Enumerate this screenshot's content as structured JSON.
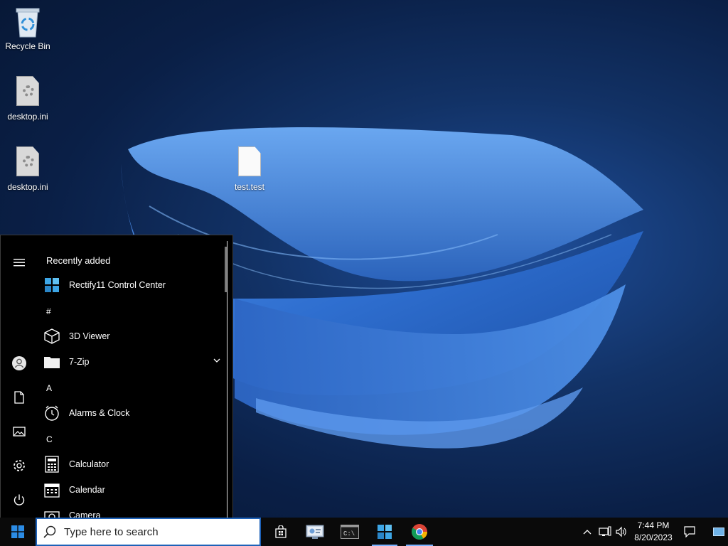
{
  "desktop": {
    "icons": [
      {
        "label": "Recycle Bin",
        "icon": "recycle-bin-icon"
      },
      {
        "label": "desktop.ini",
        "icon": "settings-file-icon"
      },
      {
        "label": "desktop.ini",
        "icon": "settings-file-icon"
      },
      {
        "label": "test.test",
        "icon": "blank-file-icon"
      }
    ]
  },
  "start_menu": {
    "recent_header": "Recently added",
    "recent_app": "Rectify11 Control Center",
    "sections": [
      "#",
      "A",
      "C"
    ],
    "apps": [
      {
        "label": "3D Viewer",
        "icon": "cube-icon"
      },
      {
        "label": "7-Zip",
        "icon": "folder-icon"
      },
      {
        "label": "Alarms & Clock",
        "icon": "clock-icon"
      },
      {
        "label": "Calculator",
        "icon": "calculator-icon"
      },
      {
        "label": "Calendar",
        "icon": "calendar-icon"
      },
      {
        "label": "Camera",
        "icon": "camera-icon"
      }
    ],
    "rail": [
      "menu-icon",
      "user-icon",
      "documents-icon",
      "pictures-icon",
      "settings-icon",
      "power-icon"
    ]
  },
  "taskbar": {
    "search_placeholder": "Type here to search",
    "pinned": [
      "store-icon",
      "control-panel-icon",
      "cmd-icon",
      "rectify11-icon",
      "chrome-icon"
    ],
    "tray": {
      "time": "7:44 PM",
      "date": "8/20/2023"
    }
  },
  "colors": {
    "taskbar_bg": "#0a0a0a",
    "start_bg": "#000000",
    "accent": "#1e62b8"
  }
}
